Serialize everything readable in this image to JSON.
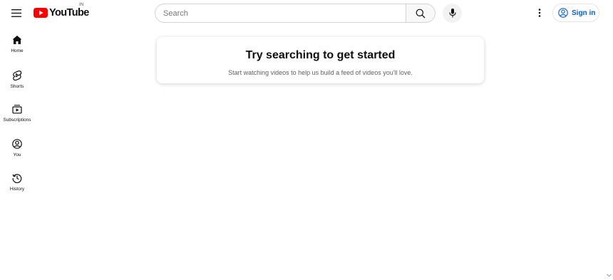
{
  "header": {
    "menu_icon": "hamburger-menu-icon",
    "logo_text": "YouTube",
    "country_code": "IN",
    "search": {
      "placeholder": "Search",
      "value": ""
    },
    "search_icon": "search-icon",
    "mic_icon": "microphone-icon",
    "more_icon": "vertical-dots-icon",
    "signin_label": "Sign in",
    "signin_icon": "account-circle-icon"
  },
  "sidebar": {
    "items": [
      {
        "label": "Home",
        "icon": "home-icon"
      },
      {
        "label": "Shorts",
        "icon": "shorts-icon"
      },
      {
        "label": "Subscriptions",
        "icon": "subscriptions-icon"
      },
      {
        "label": "You",
        "icon": "you-icon"
      },
      {
        "label": "History",
        "icon": "history-icon"
      }
    ]
  },
  "main": {
    "prompt_title": "Try searching to get started",
    "prompt_subtitle": "Start watching videos to help us build a feed of videos you'll love."
  },
  "colors": {
    "brand_red": "#ff0000",
    "link_blue": "#065fd4",
    "text_primary": "#0f0f0f",
    "text_secondary": "#606060"
  }
}
